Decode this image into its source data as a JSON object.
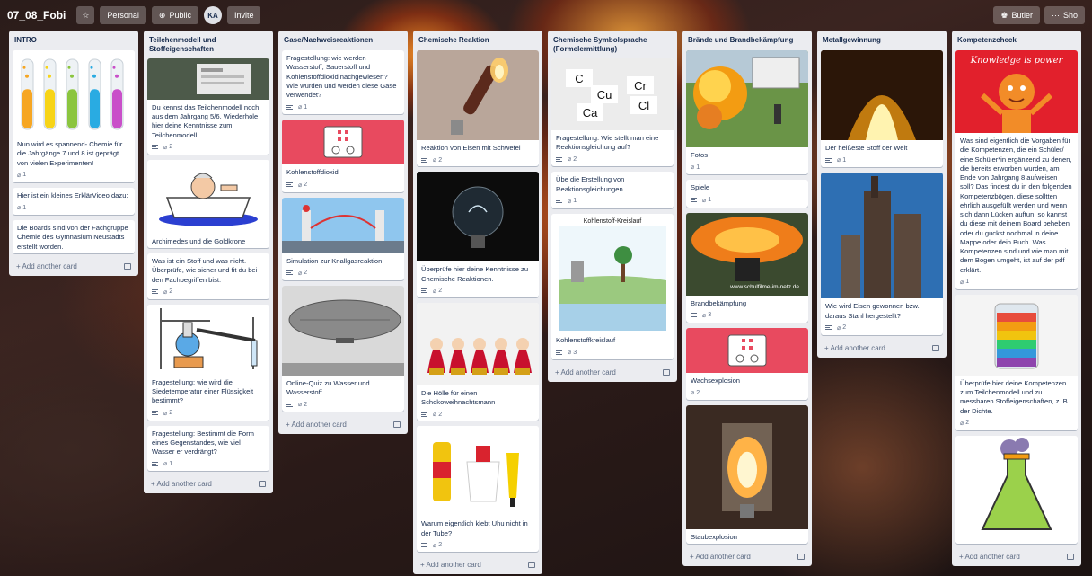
{
  "board": {
    "title": "07_08_Fobi",
    "visibility_personal": "Personal",
    "visibility_public": "Public",
    "avatar_initials": "KA",
    "invite_label": "Invite",
    "butler_label": "Butler",
    "show_menu_label": "Sho"
  },
  "add_card_label": "+ Add another card",
  "lists": [
    {
      "title": "INTRO",
      "cards": [
        {
          "text": "Nun wird es spannend- Chemie für die Jahrgänge 7 und 8 ist geprägt von vielen Experimenten!",
          "image": "test-tubes",
          "attachments": "1",
          "has_desc": false
        },
        {
          "text": "Hier ist ein kleines ErklärVideo dazu:",
          "image": "",
          "attachments": "1",
          "has_desc": false
        },
        {
          "text": "Die Boards sind von der Fachgruppe Chemie des Gymnasium Neustadts erstellt worden.",
          "image": "",
          "attachments": "",
          "has_desc": false
        }
      ]
    },
    {
      "title": "Teilchenmodell und Stoffeigenschaften",
      "cards": [
        {
          "text": "Du kennst das Teilchenmodell noch aus dem Jahrgang 5/6. Wiederhole hier deine Kenntnisse zum Teilchenmodell.",
          "image": "screen",
          "attachments": "2",
          "has_desc": true
        },
        {
          "text": "Archimedes und die Goldkrone",
          "image": "bathtub",
          "attachments": "",
          "has_desc": false
        },
        {
          "text": "Was ist ein Stoff und was nicht. Überprüfe, wie sicher und fit du bei den Fachbegriffen bist.",
          "image": "",
          "attachments": "2",
          "has_desc": true
        },
        {
          "text": "Fragestellung: wie wird die Siedetemperatur einer Flüssigkeit bestimmt?",
          "image": "lab-setup",
          "attachments": "2",
          "has_desc": true
        },
        {
          "text": "Fragestellung: Bestimmt die Form eines Gegenstandes, wie viel Wasser er verdrängt?",
          "image": "",
          "attachments": "1",
          "has_desc": true
        }
      ]
    },
    {
      "title": "Gase/Nachweisreaktionen",
      "cards": [
        {
          "text": "Fragestellung: wie werden Wasserstoff, Sauerstoff und Kohlenstoffdioxid nachgewiesen? Wie wurden und werden diese Gase verwendet?",
          "image": "",
          "attachments": "1",
          "has_desc": true
        },
        {
          "text": "Kohlenstoffdioxid",
          "image": "first-aid",
          "attachments": "2",
          "has_desc": true
        },
        {
          "text": "Simulation zur Knallgasreaktion",
          "image": "simulation",
          "attachments": "2",
          "has_desc": true
        },
        {
          "text": "Online-Quiz zu Wasser und Wasserstoff",
          "image": "zeppelin",
          "attachments": "2",
          "has_desc": true
        }
      ]
    },
    {
      "title": "Chemische Reaktion",
      "cards": [
        {
          "text": "Reaktion von Eisen mit Schwefel",
          "image": "burning-tube",
          "attachments": "2",
          "has_desc": true
        },
        {
          "text": "Überprüfe hier deine Kenntnisse zu Chemische Reaktionen.",
          "image": "bulb",
          "attachments": "2",
          "has_desc": true
        },
        {
          "text": "Die Hölle für einen Schokoweihnachtsmann",
          "image": "santas",
          "attachments": "2",
          "has_desc": true
        },
        {
          "text": "Warum eigentlich klebt Uhu nicht in der Tube?",
          "image": "glue",
          "attachments": "2",
          "has_desc": true
        }
      ]
    },
    {
      "title": "Chemische Symbolsprache (Formelermittlung)",
      "cards": [
        {
          "text": "Fragestellung: Wie stellt man eine Reaktionsgleichung auf?",
          "image": "symbols",
          "attachments": "2",
          "has_desc": true
        },
        {
          "text": "Übe die Erstellung von Reaktionsgleichungen.",
          "image": "",
          "attachments": "1",
          "has_desc": true
        },
        {
          "text": "Kohlenstoffkreislauf",
          "image": "carbon-cycle",
          "image_caption": "Kohlenstoff-Kreislauf",
          "attachments": "3",
          "has_desc": true
        }
      ]
    },
    {
      "title": "Brände und Brandbekämpfung",
      "cards": [
        {
          "text": "Fotos",
          "image": "fire-explosion",
          "attachments": "1",
          "has_desc": false
        },
        {
          "text": "Spiele",
          "image": "",
          "attachments": "1",
          "has_desc": true
        },
        {
          "text": "Brandbekämpfung",
          "image": "fire-pot",
          "image_caption": "www.schulfilme-im-netz.de",
          "attachments": "3",
          "has_desc": true
        },
        {
          "text": "Wachsexplosion",
          "image": "first-aid",
          "attachments": "2",
          "has_desc": false
        },
        {
          "text": "Staubexplosion",
          "image": "dust-explosion",
          "attachments": "",
          "has_desc": false
        }
      ]
    },
    {
      "title": "Metallgewinnung",
      "cards": [
        {
          "text": "Der heißeste Stoff der Welt",
          "image": "molten",
          "attachments": "1",
          "has_desc": true
        },
        {
          "text": "Wie wird Eisen gewonnen bzw. daraus Stahl hergestellt?",
          "image": "blast-furnace",
          "attachments": "2",
          "has_desc": true
        }
      ]
    },
    {
      "title": "Kompetenzcheck",
      "cards": [
        {
          "text": "Was sind eigentlich die Vorgaben für die Kompetenzen, die ein Schüler/ eine Schüler*in ergänzend zu denen, die bereits erworben wurden, am Ende von Jahrgang 8 aufweisen soll? Das findest du in den folgenden Kompetenzbögen, diese solltten ehrlich ausgefüllt werden und wenn sich dann Lücken auftun, so kannst du diese mit deinem Board beheben oder du guckst nochmal in deine Mappe oder dein Buch. Was Kompetenzen sind und wie man mit dem Bogen umgeht, ist auf der pdf erklärt.",
          "image": "knowledge",
          "image_caption": "Knowledge is power",
          "attachments": "1",
          "has_desc": false
        },
        {
          "text": "Überprüfe hier deine Kompetenzen zum Teilchenmodell und zu messbaren Stoffeigenschaften, z. B. der Dichte.",
          "image": "layers-jar",
          "attachments": "2",
          "has_desc": false
        },
        {
          "text": "",
          "image": "flask",
          "attachments": "",
          "has_desc": false
        }
      ]
    }
  ]
}
